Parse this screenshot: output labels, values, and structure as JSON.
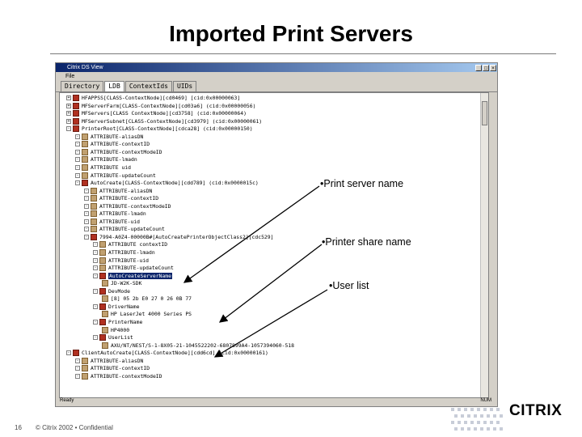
{
  "slide": {
    "title": "Imported Print Servers",
    "page_number": "16",
    "footer": "© Citrix 2002  •  Confidential",
    "brand": "CITRIX"
  },
  "window": {
    "title": "Citrix DS View",
    "menu": [
      "File"
    ],
    "tabs": [
      "Directory",
      "LDB",
      "ContextIds",
      "UIDs"
    ],
    "active_tab": "LDB",
    "status_left": "Ready",
    "status_right": "NUM"
  },
  "tree_rows": [
    {
      "indent": 0,
      "exp": "+",
      "icon": "node",
      "text": "HFAPPSS[CLASS-ContextNode][cd0469] [cid:0x00000063]"
    },
    {
      "indent": 0,
      "exp": "+",
      "icon": "node",
      "text": "MFServerFarm[CLASS-ContextNode][cd03a6] (cid:0x00000056)"
    },
    {
      "indent": 0,
      "exp": "+",
      "icon": "node",
      "text": "MFServers[CLASS ContextNode][cd3758] (cid:0x00000064)"
    },
    {
      "indent": 0,
      "exp": "+",
      "icon": "node",
      "text": "MFServerSubnet[CLASS-ContextNode][cd3979] (cid:0x00000061)"
    },
    {
      "indent": 0,
      "exp": "-",
      "icon": "node",
      "text": "PrinterRoot[CLASS-ContextNode][cdca28] (cid:0x00000150)"
    },
    {
      "indent": 1,
      "exp": "-",
      "icon": "attr",
      "text": "ATTRIBUTE-aliasDN"
    },
    {
      "indent": 1,
      "exp": "-",
      "icon": "attr",
      "text": "ATTRIBUTE-contextID"
    },
    {
      "indent": 1,
      "exp": "-",
      "icon": "attr",
      "text": "ATTRIBUTE-contextModeID"
    },
    {
      "indent": 1,
      "exp": "-",
      "icon": "attr",
      "text": "ATTRIBUTE-lmadn"
    },
    {
      "indent": 1,
      "exp": "-",
      "icon": "attr",
      "text": "ATTRIBUTE uid"
    },
    {
      "indent": 1,
      "exp": "-",
      "icon": "attr",
      "text": "ATTRIBUTE-updateCount"
    },
    {
      "indent": 1,
      "exp": "-",
      "icon": "node",
      "text": "AutoCreate[CLASS-ContextNode][cdd789] (cid:0x0000015c)"
    },
    {
      "indent": 2,
      "exp": "-",
      "icon": "attr",
      "text": "ATTRIBUTE-aliasDN"
    },
    {
      "indent": 2,
      "exp": "-",
      "icon": "attr",
      "text": "ATTRIBUTE-contextID"
    },
    {
      "indent": 2,
      "exp": "-",
      "icon": "attr",
      "text": "ATTRIBUTE-contextModeID"
    },
    {
      "indent": 2,
      "exp": "-",
      "icon": "attr",
      "text": "ATTRIBUTE-lmadn"
    },
    {
      "indent": 2,
      "exp": "-",
      "icon": "attr",
      "text": "ATTRIBUTE-uid"
    },
    {
      "indent": 2,
      "exp": "-",
      "icon": "attr",
      "text": "ATTRIBUTE-updateCount"
    },
    {
      "indent": 2,
      "exp": "-",
      "icon": "node",
      "text": "7994-A0Z4-00000B#[AutoCreatePrinterObjectClass2][cdc529]"
    },
    {
      "indent": 3,
      "exp": "-",
      "icon": "attr",
      "text": "ATTRIBUTE contextID"
    },
    {
      "indent": 3,
      "exp": "-",
      "icon": "attr",
      "text": "ATTRIBUTE-lmadn"
    },
    {
      "indent": 3,
      "exp": "-",
      "icon": "attr",
      "text": "ATTRIBUTE-uid"
    },
    {
      "indent": 3,
      "exp": "-",
      "icon": "attr",
      "text": "ATTRIBUTE-updateCount"
    },
    {
      "indent": 3,
      "exp": "-",
      "icon": "node",
      "text": "AutoCreateServerName",
      "selected": true
    },
    {
      "indent": 4,
      "exp": "",
      "icon": "attr",
      "text": "JD-W2K-SDK"
    },
    {
      "indent": 3,
      "exp": "-",
      "icon": "node",
      "text": "DevMode"
    },
    {
      "indent": 4,
      "exp": "",
      "icon": "attr",
      "text": "[8] 05 2b E0 27 0 26 0B 77"
    },
    {
      "indent": 3,
      "exp": "-",
      "icon": "node",
      "text": "DriverName"
    },
    {
      "indent": 4,
      "exp": "",
      "icon": "attr",
      "text": "HP LaserJet 4000 Series PS"
    },
    {
      "indent": 3,
      "exp": "-",
      "icon": "node",
      "text": "PrinterName"
    },
    {
      "indent": 4,
      "exp": "",
      "icon": "attr",
      "text": "HP4000"
    },
    {
      "indent": 3,
      "exp": "-",
      "icon": "node",
      "text": "UserList"
    },
    {
      "indent": 4,
      "exp": "",
      "icon": "attr",
      "text": "AXU/NT/NEST/S-1-8X05-21-1045522202-6807899A4-1057394060-518"
    },
    {
      "indent": 0,
      "exp": "-",
      "icon": "node",
      "text": "ClientAutoCreate[CLASS-ContextNode][cdd6cd] (cid:0x00000161)"
    },
    {
      "indent": 1,
      "exp": "-",
      "icon": "attr",
      "text": "ATTRIBUTE-aliasDN"
    },
    {
      "indent": 1,
      "exp": "-",
      "icon": "attr",
      "text": "ATTRIBUTE-contextID"
    },
    {
      "indent": 1,
      "exp": "-",
      "icon": "attr",
      "text": "ATTRIBUTE-contextModeID"
    }
  ],
  "callouts": {
    "print_server": "•Print server name",
    "printer_share": "•Printer share name",
    "user_list": "•User list"
  }
}
